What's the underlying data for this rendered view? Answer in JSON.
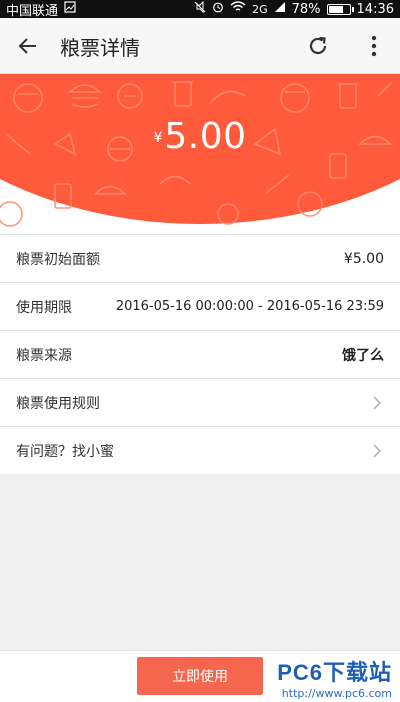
{
  "status_bar": {
    "carrier": "中国联通",
    "battery_percent": "78%",
    "network": "2G",
    "time": "14:36",
    "battery_level": 0.78
  },
  "app_bar": {
    "title": "粮票详情"
  },
  "hero": {
    "currency_symbol": "¥",
    "amount": "5.00",
    "color": "#ff5a3c"
  },
  "details": [
    {
      "label": "粮票初始面额",
      "value": "¥5.00"
    },
    {
      "label": "使用期限",
      "value": "2016-05-16 00:00:00 - 2016-05-16 23:59"
    },
    {
      "label": "粮票来源",
      "value": "饿了么"
    },
    {
      "label": "粮票使用规则"
    },
    {
      "label": "有问题？找小蜜"
    }
  ],
  "bottom_bar": {
    "use_button": "立即使用",
    "button_color": "#f4664d"
  },
  "watermark": {
    "brand": "PC6下载站",
    "url": "http://www.pc6.com"
  }
}
